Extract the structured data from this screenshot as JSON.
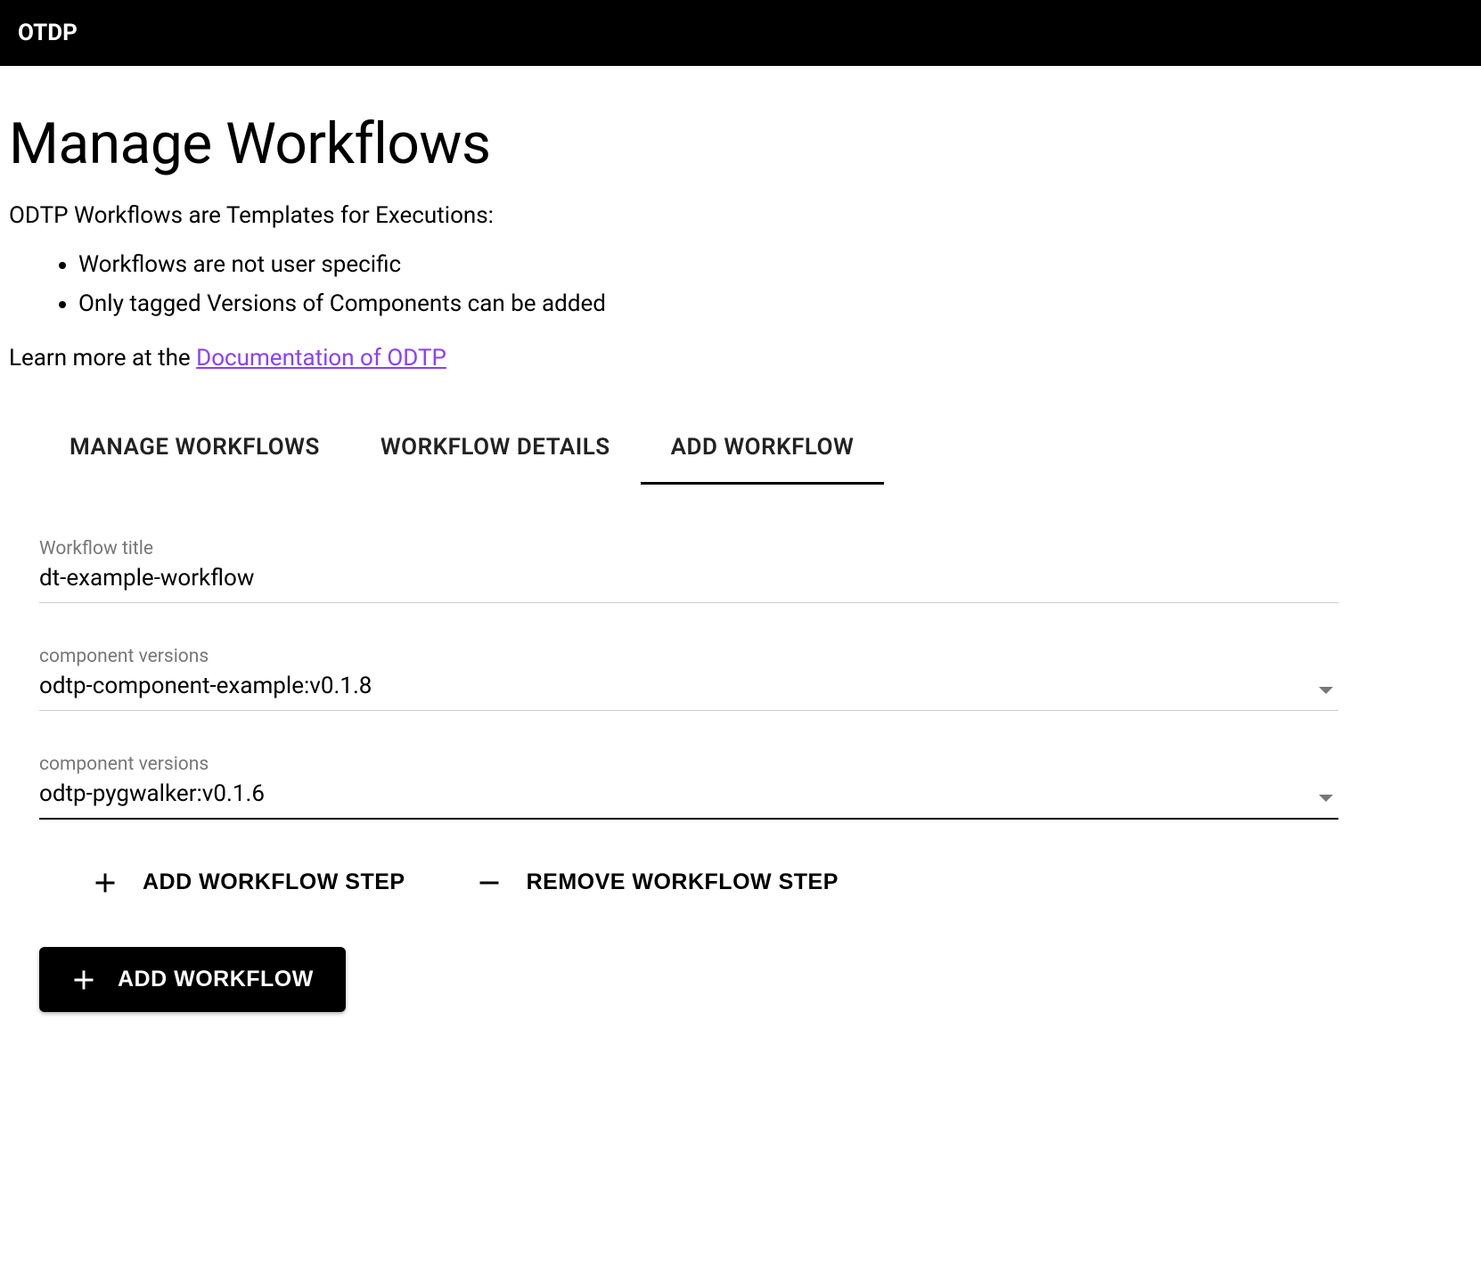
{
  "header": {
    "app_name": "OTDP"
  },
  "page": {
    "title": "Manage Workflows",
    "intro": "ODTP Workflows are Templates for Executions:",
    "bullets": [
      "Workflows are not user specific",
      "Only tagged Versions of Components can be added"
    ],
    "learn_prefix": "Learn more at the ",
    "doc_link_text": "Documentation of ODTP"
  },
  "tabs": [
    {
      "label": "MANAGE WORKFLOWS",
      "active": false
    },
    {
      "label": "WORKFLOW DETAILS",
      "active": false
    },
    {
      "label": "ADD WORKFLOW",
      "active": true
    }
  ],
  "form": {
    "title_field": {
      "label": "Workflow title",
      "value": "dt-example-workflow"
    },
    "steps": [
      {
        "label": "component versions",
        "value": "odtp-component-example:v0.1.8",
        "active": false
      },
      {
        "label": "component versions",
        "value": "odtp-pygwalker:v0.1.6",
        "active": true
      }
    ]
  },
  "actions": {
    "add_step": "ADD WORKFLOW STEP",
    "remove_step": "REMOVE WORKFLOW STEP",
    "submit": "ADD WORKFLOW"
  }
}
